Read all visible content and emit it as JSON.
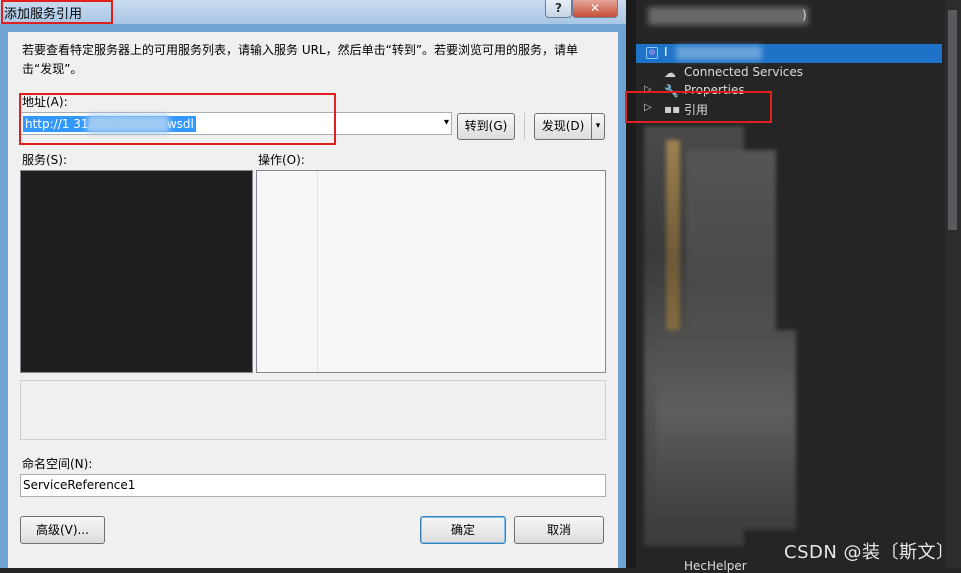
{
  "dialog": {
    "title": "添加服务引用",
    "help_symbol": "?",
    "close_symbol": "✕",
    "description": "若要查看特定服务器上的可用服务列表，请输入服务 URL，然后单击“转到”。若要浏览可用的服务，请单击“发现”。",
    "address_label": "地址(A):",
    "address_value": "http://1          31/WebService.wsdl",
    "address_dropdown_symbol": "▾",
    "goto_button": "转到(G)",
    "discover_button": "发现(D)",
    "discover_dropdown_symbol": "▾",
    "services_label": "服务(S):",
    "operations_label": "操作(O):",
    "namespace_label": "命名空间(N):",
    "namespace_value": "ServiceReference1",
    "advanced_button": "高级(V)...",
    "ok_button": "确定",
    "cancel_button": "取消",
    "colors": {
      "highlight_border": "#e0201d",
      "selection": "#3399ff"
    }
  },
  "explorer": {
    "top_text": ")",
    "selected_item_label": "I",
    "items": [
      {
        "label": "Connected Services",
        "icon": "cloud-icon"
      },
      {
        "label": "Properties",
        "icon": "wrench-icon"
      },
      {
        "label": "引用",
        "icon": "references-icon"
      }
    ],
    "bottom_item_label": "HecHelper",
    "watermark": "CSDN @装〔斯文〕"
  }
}
